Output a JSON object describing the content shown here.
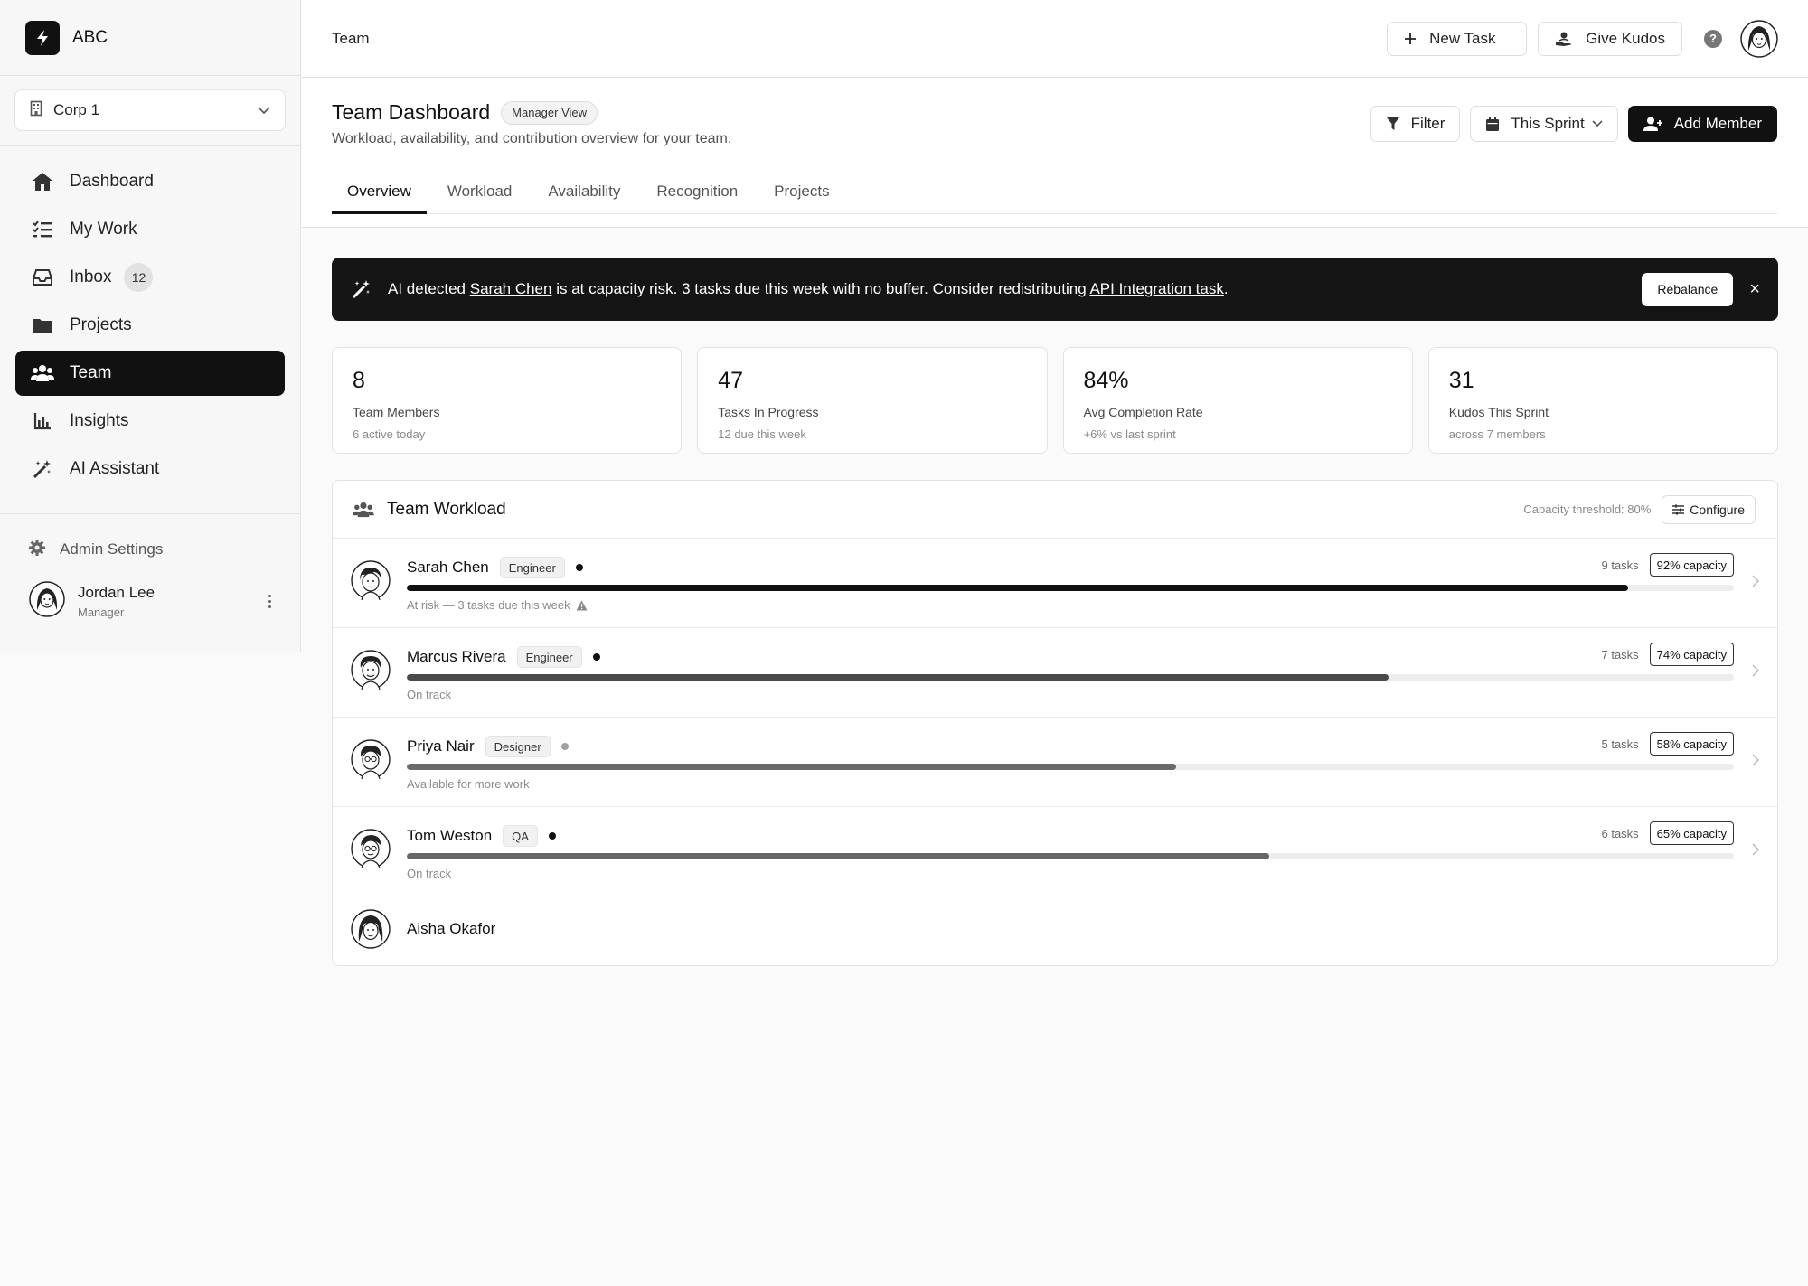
{
  "brand": {
    "name": "ABC",
    "logo_icon": "bolt-icon"
  },
  "org": {
    "name": "Corp 1"
  },
  "sidebar": {
    "items": [
      {
        "label": "Dashboard",
        "icon": "home-icon"
      },
      {
        "label": "My Work",
        "icon": "checklist-icon"
      },
      {
        "label": "Inbox",
        "icon": "inbox-icon",
        "badge": "12"
      },
      {
        "label": "Projects",
        "icon": "folder-icon"
      },
      {
        "label": "Team",
        "icon": "users-icon",
        "active": true
      },
      {
        "label": "Insights",
        "icon": "chart-icon"
      },
      {
        "label": "AI Assistant",
        "icon": "magic-wand-icon"
      }
    ],
    "admin_label": "Admin Settings",
    "user": {
      "name": "Jordan Lee",
      "role": "Manager"
    }
  },
  "topbar": {
    "breadcrumb": "Team",
    "new_task_label": "New Task",
    "give_kudos_label": "Give Kudos",
    "help_label": "?"
  },
  "page": {
    "title": "Team Dashboard",
    "badge": "Manager View",
    "subtitle": "Workload, availability, and contribution overview for your team.",
    "filter_label": "Filter",
    "sprint_label": "This Sprint",
    "add_member_label": "Add Member",
    "tabs": [
      "Overview",
      "Workload",
      "Availability",
      "Recognition",
      "Projects"
    ],
    "active_tab": "Overview"
  },
  "banner": {
    "prefix": "AI detected ",
    "person": "Sarah Chen",
    "middle": " is at capacity risk. 3 tasks due this week with no buffer. Consider redistributing ",
    "task": "API Integration task",
    "suffix": ".",
    "action_label": "Rebalance",
    "close_label": "×"
  },
  "stats": [
    {
      "value": "8",
      "label": "Team Members",
      "sub": "6 active today"
    },
    {
      "value": "47",
      "label": "Tasks In Progress",
      "sub": "12 due this week"
    },
    {
      "value": "84%",
      "label": "Avg Completion Rate",
      "sub": "+6% vs last sprint"
    },
    {
      "value": "31",
      "label": "Kudos This Sprint",
      "sub": "across 7 members"
    }
  ],
  "workload": {
    "title": "Team Workload",
    "threshold_text": "Capacity threshold: 80%",
    "configure_label": "Configure",
    "members": [
      {
        "name": "Sarah Chen",
        "role": "Engineer",
        "tasks": "9 tasks",
        "capacity_label": "92% capacity",
        "capacity": 0.92,
        "status": "At risk — 3 tasks due this week",
        "dot": "#111111",
        "bar_color": "#111111",
        "warn": true
      },
      {
        "name": "Marcus Rivera",
        "role": "Engineer",
        "tasks": "7 tasks",
        "capacity_label": "74% capacity",
        "capacity": 0.74,
        "status": "On track",
        "dot": "#111111",
        "bar_color": "#4a4a4a"
      },
      {
        "name": "Priya Nair",
        "role": "Designer",
        "tasks": "5 tasks",
        "capacity_label": "58% capacity",
        "capacity": 0.58,
        "status": "Available for more work",
        "dot": "#a0a0a0",
        "bar_color": "#6a6a6a"
      },
      {
        "name": "Tom Weston",
        "role": "QA",
        "tasks": "6 tasks",
        "capacity_label": "65% capacity",
        "capacity": 0.65,
        "status": "On track",
        "dot": "#111111",
        "bar_color": "#666666"
      },
      {
        "name": "Aisha Okafor"
      }
    ]
  }
}
